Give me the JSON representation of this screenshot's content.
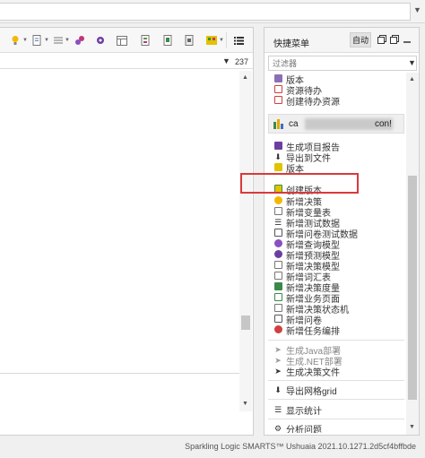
{
  "top_bar": {
    "dropdown_icon": "chevron-down-icon"
  },
  "left_panel": {
    "toolbar_icons": [
      "bulb-icon",
      "document-icon",
      "list-icon",
      "query-model-icon",
      "predictive-model-icon",
      "table-model-icon",
      "vocabulary-icon",
      "business-page-icon",
      "decision-icon",
      "grid-icon"
    ],
    "filter_count": "237"
  },
  "quick_menu": {
    "title": "快捷菜单",
    "auto_label": "自动",
    "filter_placeholder": "过滤器",
    "top_items": [
      {
        "label": "版本",
        "icon": "version-icon"
      },
      {
        "label": "资源待办",
        "icon": "todo-icon"
      },
      {
        "label": "创建待办资源",
        "icon": "create-todo-icon"
      }
    ],
    "project": {
      "name_start": "ca",
      "name_end": "con!"
    },
    "items": [
      {
        "label": "生成项目报告",
        "icon": "report-icon"
      },
      {
        "label": "导出到文件",
        "icon": "export-icon"
      },
      {
        "label": "版本",
        "icon": "version-icon"
      },
      {
        "label": "创建版本",
        "icon": "create-version-icon"
      },
      {
        "label": "新增决策",
        "icon": "bulb-icon"
      },
      {
        "label": "新增变量表",
        "icon": "document-icon"
      },
      {
        "label": "新增测试数据",
        "icon": "list-icon"
      },
      {
        "label": "新增问卷测试数据",
        "icon": "questionnaire-data-icon"
      },
      {
        "label": "新增查询模型",
        "icon": "query-model-icon"
      },
      {
        "label": "新增预测模型",
        "icon": "predictive-model-icon"
      },
      {
        "label": "新增决策模型",
        "icon": "table-model-icon"
      },
      {
        "label": "新增词汇表",
        "icon": "vocabulary-icon"
      },
      {
        "label": "新增决策度量",
        "icon": "metric-icon"
      },
      {
        "label": "新增业务页面",
        "icon": "business-page-icon"
      },
      {
        "label": "新增决策状态机",
        "icon": "state-machine-icon"
      },
      {
        "label": "新增问卷",
        "icon": "questionnaire-icon"
      },
      {
        "label": "新增任务编排",
        "icon": "orchestration-icon"
      }
    ],
    "deploy_items": [
      {
        "label": "生成Java部署",
        "icon": "rocket-icon",
        "disabled": true
      },
      {
        "label": "生成.NET部署",
        "icon": "rocket-icon",
        "disabled": true
      },
      {
        "label": "生成决策文件",
        "icon": "rocket-icon",
        "disabled": false
      }
    ],
    "export_grid": {
      "label": "导出网格grid",
      "icon": "download-icon"
    },
    "show_stats": {
      "label": "显示统计",
      "icon": "stats-icon"
    },
    "partial_item": {
      "label": "分析问题",
      "icon": "settings-icon"
    }
  },
  "footer": {
    "text": "Sparkling Logic SMARTS™ Ushuaia 2021.10.1271.2d5cf4bffbde"
  },
  "colors": {
    "highlight": "#d83a3a",
    "panel_border": "#cfcfcf"
  }
}
